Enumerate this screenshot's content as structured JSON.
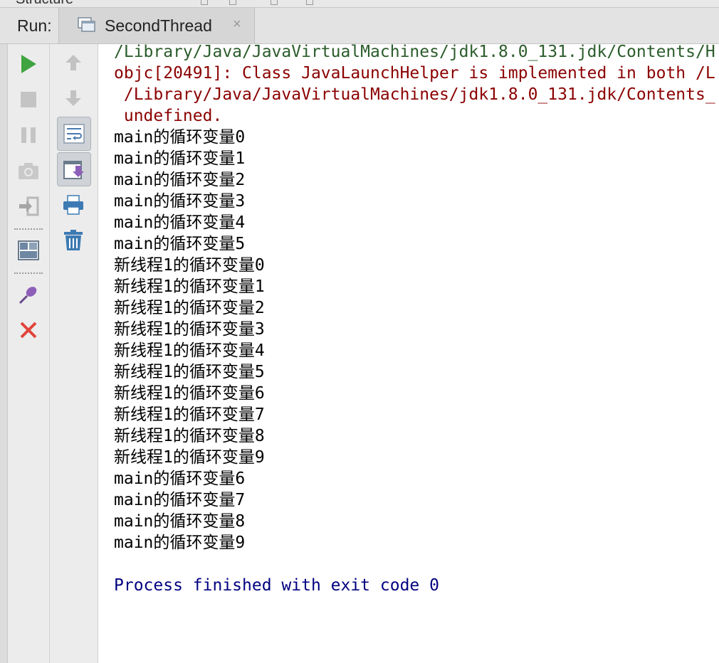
{
  "top_strip": {
    "peek_text": "Structure"
  },
  "run_bar": {
    "label": "Run:",
    "tab": {
      "title": "SecondThread",
      "close_glyph": "×"
    }
  },
  "left_toolbar": {
    "items": [
      {
        "icon": "run-icon",
        "color": "#3fa33f"
      },
      {
        "icon": "stop-icon"
      },
      {
        "icon": "pause-icon"
      },
      {
        "icon": "camera-icon"
      },
      {
        "icon": "exit-icon"
      },
      {
        "icon": "layout-icon"
      },
      {
        "icon": "pin-icon",
        "color": "#8e5fb8"
      },
      {
        "icon": "close-icon",
        "color": "#e0443a"
      }
    ]
  },
  "second_toolbar": {
    "items": [
      {
        "icon": "arrow-up-icon"
      },
      {
        "icon": "arrow-down-icon"
      },
      {
        "icon": "soft-wrap-icon"
      },
      {
        "icon": "scroll-to-end-icon"
      },
      {
        "icon": "print-icon"
      },
      {
        "icon": "trash-icon"
      }
    ]
  },
  "console": {
    "lines": [
      {
        "text": "/Library/Java/JavaVirtualMachines/jdk1.8.0_131.jdk/Contents/H",
        "kind": "path"
      },
      {
        "text": "objc[20491]: Class JavaLaunchHelper is implemented in both /L",
        "kind": "err"
      },
      {
        "text": " /Library/Java/JavaVirtualMachines/jdk1.8.0_131.jdk/Contents_",
        "kind": "err"
      },
      {
        "text": " undefined.",
        "kind": "err"
      },
      {
        "text": "main的循环变量0",
        "kind": "out"
      },
      {
        "text": "main的循环变量1",
        "kind": "out"
      },
      {
        "text": "main的循环变量2",
        "kind": "out"
      },
      {
        "text": "main的循环变量3",
        "kind": "out"
      },
      {
        "text": "main的循环变量4",
        "kind": "out"
      },
      {
        "text": "main的循环变量5",
        "kind": "out"
      },
      {
        "text": "新线程1的循环变量0",
        "kind": "out"
      },
      {
        "text": "新线程1的循环变量1",
        "kind": "out"
      },
      {
        "text": "新线程1的循环变量2",
        "kind": "out"
      },
      {
        "text": "新线程1的循环变量3",
        "kind": "out"
      },
      {
        "text": "新线程1的循环变量4",
        "kind": "out"
      },
      {
        "text": "新线程1的循环变量5",
        "kind": "out"
      },
      {
        "text": "新线程1的循环变量6",
        "kind": "out"
      },
      {
        "text": "新线程1的循环变量7",
        "kind": "out"
      },
      {
        "text": "新线程1的循环变量8",
        "kind": "out"
      },
      {
        "text": "新线程1的循环变量9",
        "kind": "out"
      },
      {
        "text": "main的循环变量6",
        "kind": "out"
      },
      {
        "text": "main的循环变量7",
        "kind": "out"
      },
      {
        "text": "main的循环变量8",
        "kind": "out"
      },
      {
        "text": "main的循环变量9",
        "kind": "out"
      },
      {
        "text": "",
        "kind": "out"
      },
      {
        "text": "Process finished with exit code 0",
        "kind": "fin"
      }
    ]
  }
}
